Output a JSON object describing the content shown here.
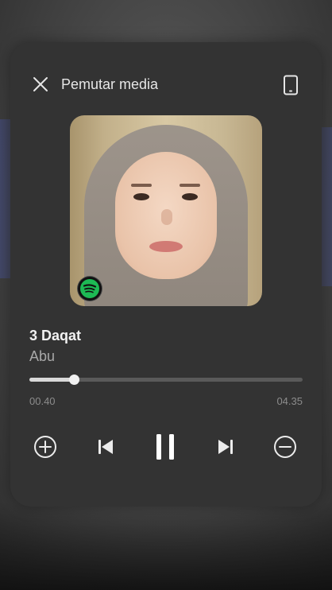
{
  "header": {
    "title": "Pemutar media",
    "close_icon": "close-icon",
    "device_icon": "phone-device-icon"
  },
  "track": {
    "title": "3 Daqat",
    "artist": "Abu",
    "current_time": "00.40",
    "total_time": "04.35",
    "progress_fraction": 0.163,
    "source_icon": "spotify-icon"
  },
  "controls": {
    "add": "add-circle-icon",
    "previous": "skip-previous-icon",
    "play_pause": "pause-icon",
    "next": "skip-next-icon",
    "remove": "remove-circle-icon"
  },
  "colors": {
    "card": "#333333",
    "spotify_green": "#1db954",
    "progress": "#d9d9d9"
  }
}
